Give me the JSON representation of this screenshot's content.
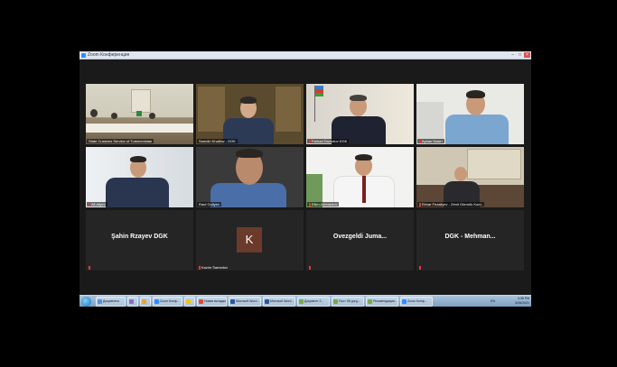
{
  "window": {
    "title": "Zoom Конференция"
  },
  "tiles": [
    {
      "name": "State Customs Service of Turkmenistan",
      "mic_muted": false
    },
    {
      "name": "Samdin Khalilov - DGK",
      "mic_muted": false
    },
    {
      "name": "Farhad Davudov DGK",
      "mic_muted": true
    },
    {
      "name": "Ayhan Nasiri",
      "mic_muted": true
    },
    {
      "name": "Ali aliyev",
      "mic_muted": true
    },
    {
      "name": "Rauf Guliyev",
      "mic_muted": false
    },
    {
      "name": "Elkin Akhmedov",
      "mic_muted": true
    },
    {
      "name": "Elmar Fezaliyev - Zenit Gömrük Kom.",
      "mic_muted": true
    },
    {
      "display": "Şahin Rzayev DGK",
      "mic_muted": true
    },
    {
      "avatar_letter": "K",
      "name": "Kazim Samedov",
      "mic_muted": true
    },
    {
      "display": "Ovezgeldi Juma...",
      "mic_muted": true
    },
    {
      "display": "DGK - Mehman...",
      "mic_muted": true
    }
  ],
  "taskbar": {
    "items": [
      {
        "label": "Документы",
        "icon_color": "#5b8fd6"
      },
      {
        "label": "",
        "icon_color": "#8e6cc0"
      },
      {
        "label": "",
        "icon_color": "#e8a23a"
      },
      {
        "label": "Zoom Конф...",
        "icon_color": "#2d8cff"
      },
      {
        "label": "",
        "icon_color": "#f1c40f"
      },
      {
        "label": "Новая вкладка",
        "icon_color": "#e04a2f"
      },
      {
        "label": "Microsoft Word...",
        "icon_color": "#2b579a"
      },
      {
        "label": "Microsoft Word...",
        "icon_color": "#2b579a"
      },
      {
        "label": "Документ 2...",
        "icon_color": "#79a84a"
      },
      {
        "label": "Пост 98 gorg...",
        "icon_color": "#79a84a"
      },
      {
        "label": "Рекомендации...",
        "icon_color": "#79a84a"
      },
      {
        "label": "Zoom Конф...",
        "icon_color": "#2d8cff"
      }
    ],
    "lang": "EN",
    "time": "4:38 PM",
    "date": "5/26/2021"
  }
}
